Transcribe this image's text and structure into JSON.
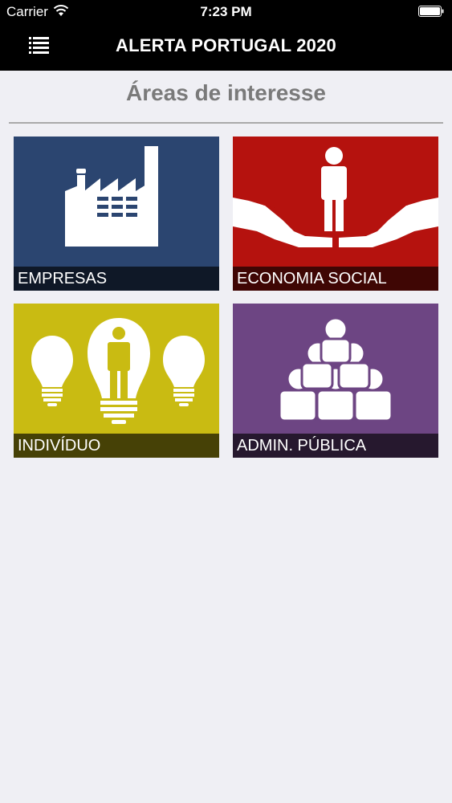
{
  "status_bar": {
    "carrier": "Carrier",
    "time": "7:23 PM"
  },
  "nav": {
    "title": "ALERTA PORTUGAL 2020",
    "menu_icon": "hamburger-menu-icon"
  },
  "section": {
    "title": "Áreas de interesse"
  },
  "tiles": [
    {
      "label": "EMPRESAS",
      "color": "#2b4570",
      "icon": "factory-icon"
    },
    {
      "label": "ECONOMIA SOCIAL",
      "color": "#b5120e",
      "icon": "hands-person-icon"
    },
    {
      "label": "INDIVÍDUO",
      "color": "#c9bb12",
      "icon": "lightbulbs-person-icon"
    },
    {
      "label": "ADMIN. PÚBLICA",
      "color": "#6d4583",
      "icon": "people-pyramid-icon"
    }
  ],
  "colors": {
    "topbar": "#000000",
    "background": "#efeff4",
    "section_title": "#7a7a7a"
  }
}
